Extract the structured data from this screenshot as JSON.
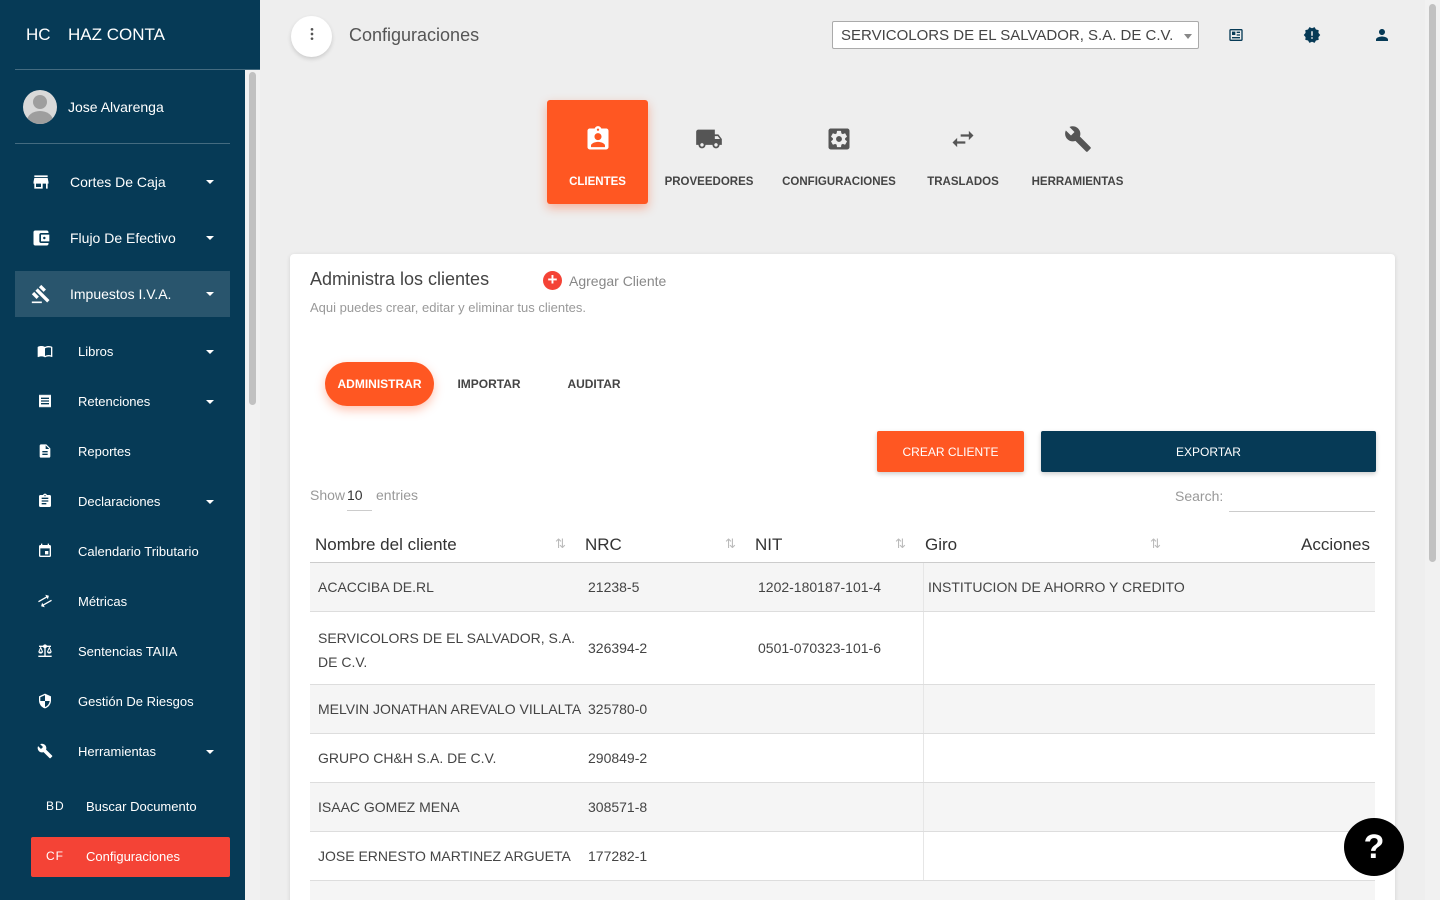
{
  "brand": {
    "mini": "HC",
    "name": "HAZ CONTA"
  },
  "user": {
    "name": "Jose Alvarenga"
  },
  "sidebar": {
    "items": [
      {
        "label": "Cortes De Caja",
        "icon": "store-icon"
      },
      {
        "label": "Flujo De Efectivo",
        "icon": "wallet-icon"
      },
      {
        "label": "Impuestos I.V.A.",
        "icon": "gavel-icon",
        "active": true
      }
    ],
    "subitems": [
      {
        "label": "Libros",
        "icon": "book-icon"
      },
      {
        "label": "Retenciones",
        "icon": "receipt-icon"
      },
      {
        "label": "Reportes",
        "icon": "document-icon"
      },
      {
        "label": "Declaraciones",
        "icon": "clipboard-icon"
      },
      {
        "label": "Calendario Tributario",
        "icon": "calendar-icon"
      },
      {
        "label": "Métricas",
        "icon": "trending-icon"
      },
      {
        "label": "Sentencias TAIIA",
        "icon": "balance-icon"
      },
      {
        "label": "Gestión De Riesgos",
        "icon": "shield-icon"
      },
      {
        "label": "Herramientas",
        "icon": "wrench-icon"
      }
    ],
    "mini_items": [
      {
        "mini": "BD",
        "label": "Buscar Documento"
      },
      {
        "mini": "CF",
        "label": "Configuraciones",
        "active": true
      }
    ]
  },
  "header": {
    "title": "Configuraciones",
    "company": "SERVICOLORS DE EL SALVADOR, S.A. DE C.V."
  },
  "config_tabs": [
    {
      "label": "CLIENTES",
      "icon": "client-badge-icon",
      "active": true
    },
    {
      "label": "PROVEEDORES",
      "icon": "truck-icon"
    },
    {
      "label": "CONFIGURACIONES",
      "icon": "settings-box-icon"
    },
    {
      "label": "TRASLADOS",
      "icon": "swap-icon"
    },
    {
      "label": "HERRAMIENTAS",
      "icon": "wrench-icon"
    }
  ],
  "card": {
    "title": "Administra los clientes",
    "add_label": "Agregar Cliente",
    "subtitle": "Aqui puedes crear, editar y eliminar tus clientes."
  },
  "pills": [
    "ADMINISTRAR",
    "IMPORTAR",
    "AUDITAR"
  ],
  "buttons": {
    "create": "CREAR CLIENTE",
    "export": "EXPORTAR"
  },
  "table_controls": {
    "show": "Show",
    "show_value": "10",
    "entries": "entries",
    "search": "Search:"
  },
  "table": {
    "headers": [
      "Nombre del cliente",
      "NRC",
      "NIT",
      "Giro",
      "Acciones"
    ],
    "rows": [
      {
        "nombre": "ACACCIBA DE.RL",
        "nrc": "21238-5",
        "nit": "1202-180187-101-4",
        "giro": "INSTITUCION DE AHORRO Y CREDITO"
      },
      {
        "nombre": "SERVICOLORS DE EL SALVADOR, S.A. DE C.V.",
        "nrc": "326394-2",
        "nit": "0501-070323-101-6",
        "giro": ""
      },
      {
        "nombre": "MELVIN JONATHAN AREVALO VILLALTA",
        "nrc": "325780-0",
        "nit": "",
        "giro": ""
      },
      {
        "nombre": "GRUPO CH&H S.A. DE C.V.",
        "nrc": "290849-2",
        "nit": "",
        "giro": ""
      },
      {
        "nombre": "ISAAC GOMEZ MENA",
        "nrc": "308571-8",
        "nit": "",
        "giro": ""
      },
      {
        "nombre": "JOSE ERNESTO MARTINEZ ARGUETA",
        "nrc": "177282-1",
        "nit": "",
        "giro": ""
      }
    ]
  },
  "help": "?",
  "colors": {
    "sidebar": "#063a56",
    "accent": "#ff5722",
    "danger": "#f44336"
  }
}
